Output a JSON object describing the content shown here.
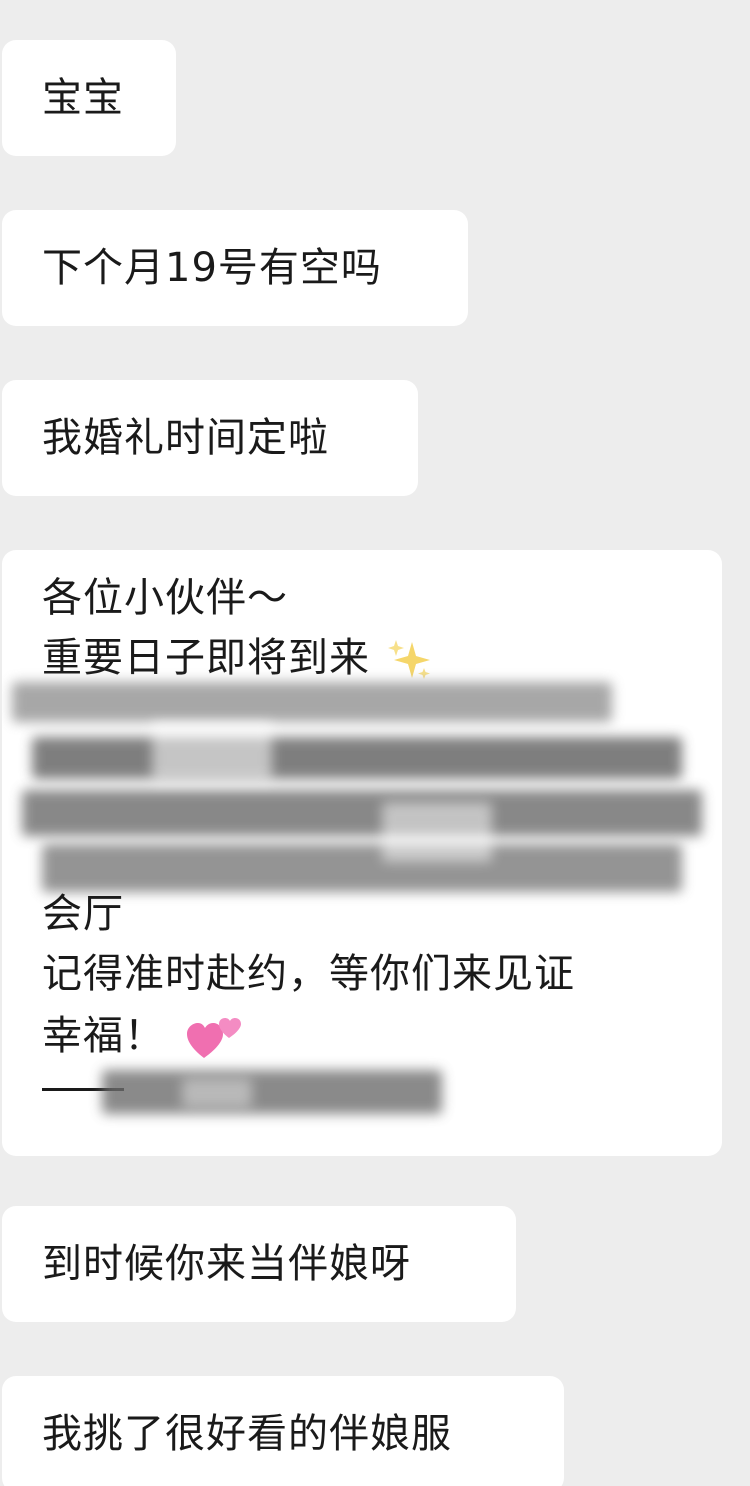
{
  "messages": [
    {
      "text": "宝宝"
    },
    {
      "text": "下个月19号有空吗"
    },
    {
      "text": "我婚礼时间定啦"
    },
    {
      "lines": [
        "各位小伙伴～",
        "重要日子即将到来",
        "会厅",
        "记得准时赴约，等你们来见证",
        "幸福！",
        "—"
      ],
      "emojis": {
        "sparkle": "sparkles-emoji",
        "hearts": "two-hearts-emoji"
      }
    },
    {
      "text": "到时候你来当伴娘呀"
    },
    {
      "text": "我挑了很好看的伴娘服"
    }
  ],
  "colors": {
    "background": "#ededed",
    "bubble": "#ffffff",
    "text": "#1a1a1a",
    "redaction": "#6b6b6b",
    "heart": "#f06fb0",
    "sparkle": "#f5d66a"
  }
}
